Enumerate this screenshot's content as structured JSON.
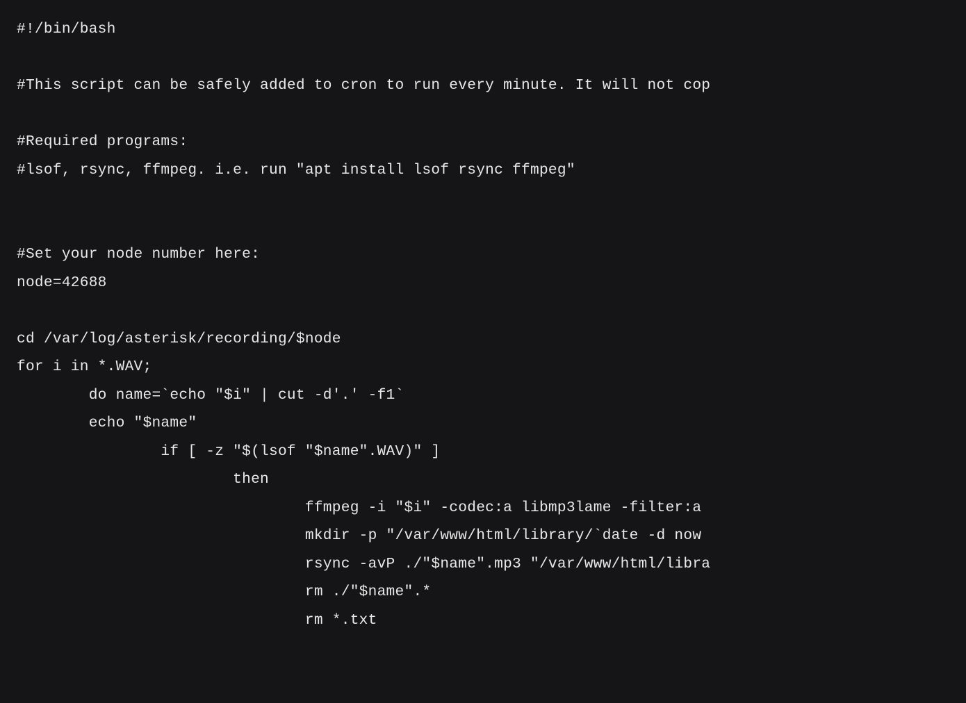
{
  "code": {
    "lines": [
      "#!/bin/bash",
      "",
      "#This script can be safely added to cron to run every minute. It will not cop",
      "",
      "#Required programs:",
      "#lsof, rsync, ffmpeg. i.e. run \"apt install lsof rsync ffmpeg\"",
      "",
      "",
      "#Set your node number here:",
      "node=42688",
      "",
      "cd /var/log/asterisk/recording/$node",
      "for i in *.WAV;",
      "        do name=`echo \"$i\" | cut -d'.' -f1`",
      "        echo \"$name\"",
      "                if [ -z \"$(lsof \"$name\".WAV)\" ]",
      "                        then",
      "                                ffmpeg -i \"$i\" -codec:a libmp3lame -filter:a ",
      "                                mkdir -p \"/var/www/html/library/`date -d now ",
      "                                rsync -avP ./\"$name\".mp3 \"/var/www/html/libra",
      "                                rm ./\"$name\".*",
      "                                rm *.txt"
    ]
  }
}
